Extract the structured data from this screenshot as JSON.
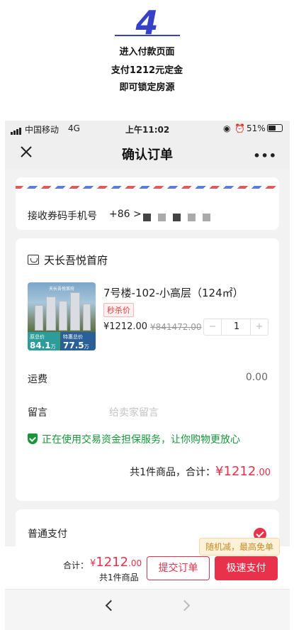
{
  "step": {
    "number": "4",
    "line1": "进入付款页面",
    "line2": "支付1212元定金",
    "line3": "即可锁定房源"
  },
  "status_bar": {
    "carrier": "中国移动",
    "network": "4G",
    "time": "上午11:02",
    "battery": "51%"
  },
  "nav": {
    "title": "确认订单",
    "more": "•••"
  },
  "phone_row": {
    "label": "接收券码手机号",
    "prefix": "+86",
    "chevron": ">"
  },
  "shop": {
    "name": "天长吾悦首府",
    "icon": "store-icon"
  },
  "product": {
    "title": "7号楼-102-小高层（124㎡）",
    "tag": "秒杀价",
    "price": "¥1212.00",
    "original_price": "¥841472.00",
    "quantity": "1",
    "minus": "−",
    "plus": "+",
    "thumb_label_1": "原总价",
    "thumb_value_1": "84.1",
    "thumb_label_2": "特惠总价",
    "thumb_value_2": "77.5",
    "thumb_unit": "万元"
  },
  "shipping": {
    "label": "运费",
    "value": "0.00"
  },
  "message": {
    "label": "留言",
    "placeholder": "给卖家留言"
  },
  "guarantee": {
    "text": "正在使用交易资金担保服务，让你购物更放心",
    "color": "#17973a"
  },
  "summary": {
    "count_text": "共1件商品，合计：",
    "currency": "¥",
    "amount": "1212",
    "decimals": ".00"
  },
  "payment": {
    "label": "普通支付",
    "selected": true
  },
  "promo": {
    "text": "随机减，最高免单"
  },
  "bottom": {
    "total_label": "合计：",
    "currency": "¥",
    "amount": "1212",
    "decimals": ".00",
    "count": "共1件商品",
    "submit_label": "提交订单",
    "fast_pay_label": "极速支付",
    "accent_color": "#e8314a"
  }
}
